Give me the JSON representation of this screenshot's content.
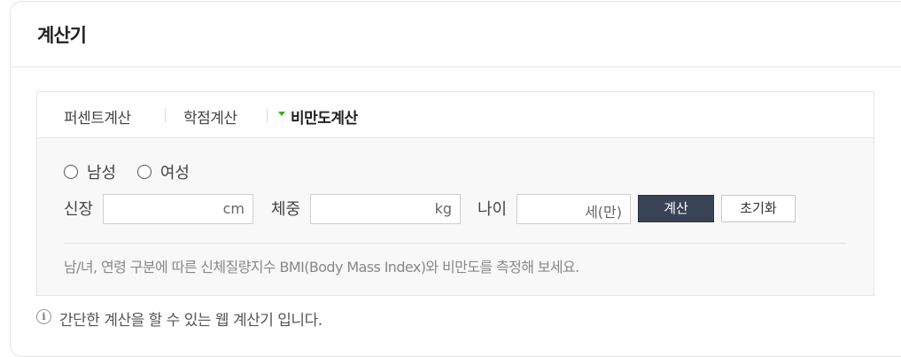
{
  "card": {
    "title": "계산기"
  },
  "tabs": [
    {
      "label": "퍼센트계산",
      "active": false
    },
    {
      "label": "학점계산",
      "active": false
    },
    {
      "label": "비만도계산",
      "active": true
    }
  ],
  "accent_color": "#2db400",
  "gender": {
    "options": [
      "남성",
      "여성"
    ],
    "selected": null
  },
  "fields": {
    "height": {
      "label": "신장",
      "value": "",
      "unit": "cm"
    },
    "weight": {
      "label": "체중",
      "value": "",
      "unit": "kg"
    },
    "age": {
      "label": "나이",
      "value": "",
      "unit": "세(만)"
    }
  },
  "buttons": {
    "calculate": "계산",
    "reset": "초기화"
  },
  "description": "남/녀, 연령 구분에 따른 신체질량지수 BMI(Body Mass Index)와 비만도를 측정해 보세요.",
  "footnote": "간단한 계산을 할 수 있는 웹 계산기 입니다.",
  "info_icon": "info-icon"
}
